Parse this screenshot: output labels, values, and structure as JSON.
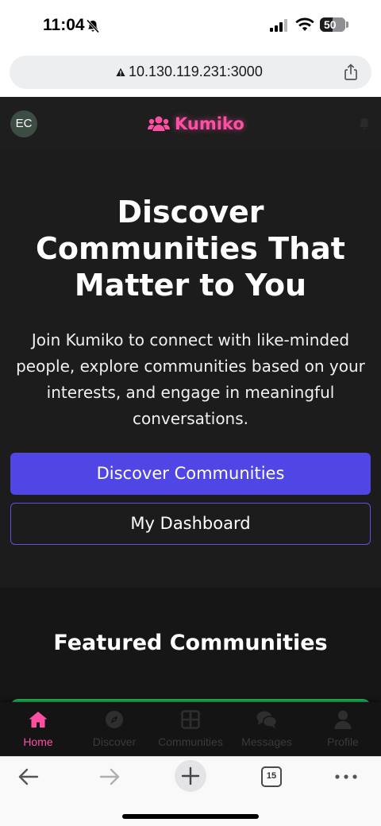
{
  "status_bar": {
    "time": "11:04",
    "battery": "50"
  },
  "browser": {
    "url": "10.130.119.231:3000",
    "tab_count": "15"
  },
  "header": {
    "avatar_initials": "EC",
    "brand": "Kumiko"
  },
  "hero": {
    "title": "Discover Communities That Matter to You",
    "subtitle": "Join Kumiko to connect with like-minded people, explore communities based on your interests, and engage in meaningful conversations.",
    "primary_button": "Discover Communities",
    "secondary_button": "My Dashboard"
  },
  "featured": {
    "title": "Featured Communities"
  },
  "bottom_nav": [
    {
      "label": "Home",
      "icon": "home-icon",
      "active": true
    },
    {
      "label": "Discover",
      "icon": "compass-icon",
      "active": false
    },
    {
      "label": "Communities",
      "icon": "grid-icon",
      "active": false
    },
    {
      "label": "Messages",
      "icon": "messages-icon",
      "active": false
    },
    {
      "label": "Profile",
      "icon": "user-icon",
      "active": false
    }
  ],
  "colors": {
    "brand_pink": "#ff4fa3",
    "primary": "#4f46e5",
    "card_green": "#22c55e",
    "background": "#1a1a1a"
  }
}
